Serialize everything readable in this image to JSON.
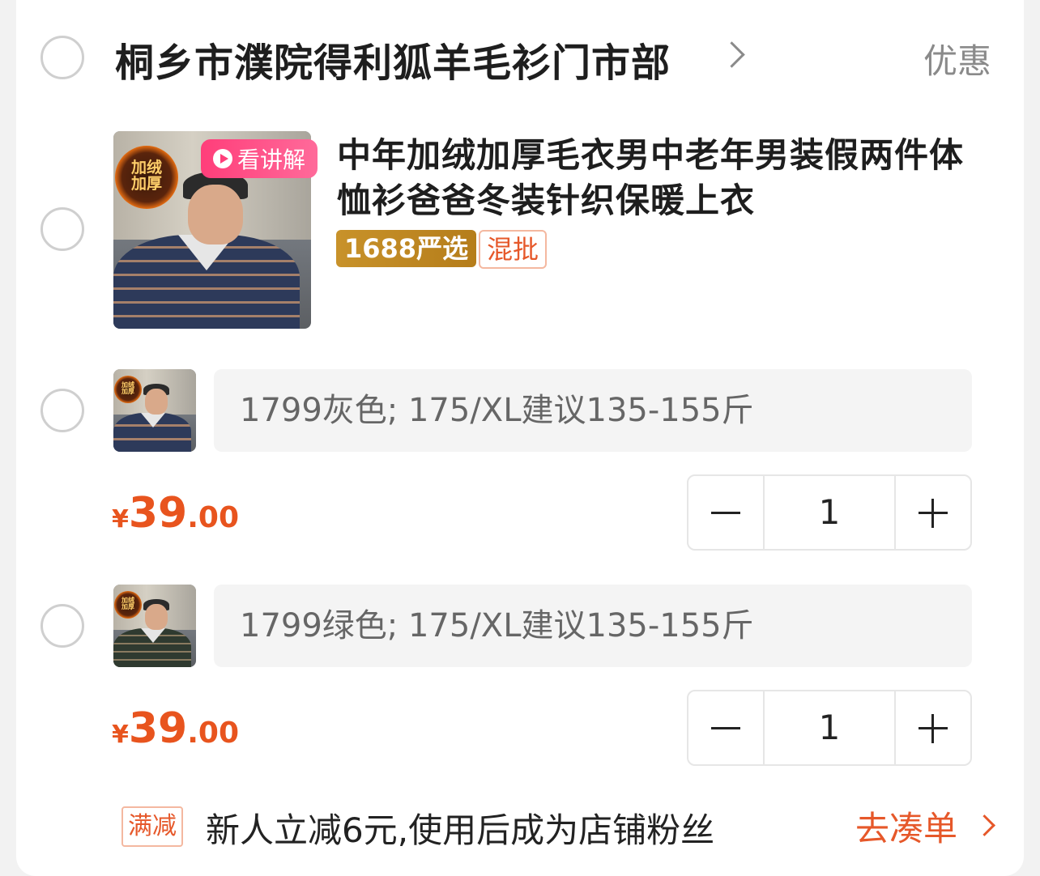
{
  "shop": {
    "name": "桐乡市濮院得利狐羊毛衫门市部",
    "promo_link": "优惠"
  },
  "product": {
    "title": "中年加绒加厚毛衣男中老年男装假两件体恤衫爸爸冬装针织保暖上衣",
    "video_tag": "看讲解",
    "thumb_badge_line1": "加绒",
    "thumb_badge_line2": "加厚",
    "tags": {
      "selected": "1688严选",
      "mixed": "混批"
    }
  },
  "skus": [
    {
      "spec": "1799灰色; 175/XL建议135-155斤",
      "price_symbol": "¥",
      "price_int": "39",
      "price_dec": ".00",
      "quantity": "1",
      "thumb_badge_line1": "加绒",
      "thumb_badge_line2": "加厚"
    },
    {
      "spec": "1799绿色; 175/XL建议135-155斤",
      "price_symbol": "¥",
      "price_int": "39",
      "price_dec": ".00",
      "quantity": "1",
      "thumb_badge_line1": "加绒",
      "thumb_badge_line2": "加厚"
    }
  ],
  "promotion": {
    "tag": "满减",
    "text": "新人立减6元,使用后成为店铺粉丝",
    "action": "去凑单"
  },
  "colors": {
    "accent": "#e8541e",
    "video_tag": "#ff3e7a",
    "gold_tag": "#c8922a"
  },
  "icons": {
    "shop_chevron": "chevron-right-icon",
    "play": "play-icon",
    "minus": "minus-icon",
    "plus": "plus-icon",
    "promo_chevron": "chevron-right-icon"
  }
}
